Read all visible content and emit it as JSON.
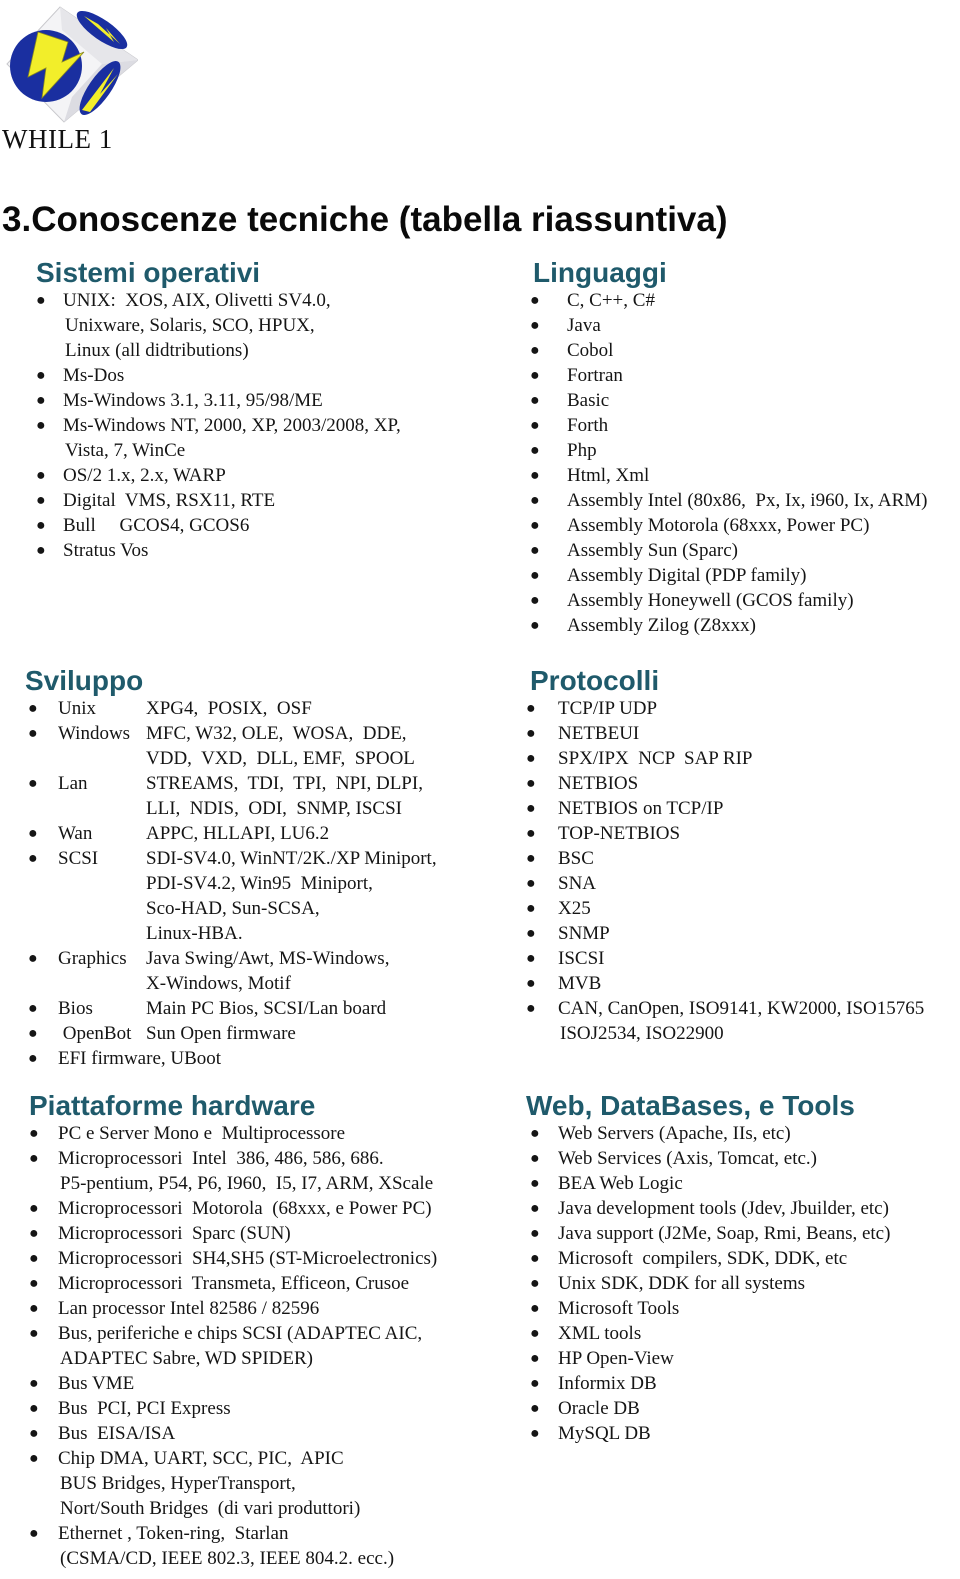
{
  "header": {
    "brand": "WHILE 1",
    "logo_icon": "while1-cube-logo",
    "title": "3.Conoscenze tecniche (tabella riassuntiva)"
  },
  "colors": {
    "heading": "#1f5a6b",
    "text": "#151515",
    "logo_blue": "#1a2fa0",
    "logo_yellow": "#f2ee2a"
  },
  "sections": {
    "sistemi": {
      "title": "Sistemi operativi",
      "items": [
        [
          "UNIX:  XOS, AIX, Olivetti SV4.0,",
          "Unixware, Solaris, SCO, HPUX,",
          "Linux (all didtributions)"
        ],
        [
          "Ms-Dos"
        ],
        [
          "Ms-Windows 3.1, 3.11, 95/98/ME"
        ],
        [
          "Ms-Windows NT, 2000, XP, 2003/2008, XP,",
          "Vista, 7, WinCe"
        ],
        [
          "OS/2 1.x, 2.x, WARP"
        ],
        [
          "Digital  VMS, RSX11, RTE"
        ],
        [
          "Bull     GCOS4, GCOS6"
        ],
        [
          "Stratus Vos"
        ]
      ]
    },
    "linguaggi": {
      "title": "Linguaggi",
      "items": [
        [
          "C, C++, C#"
        ],
        [
          "Java"
        ],
        [
          "Cobol"
        ],
        [
          "Fortran"
        ],
        [
          "Basic"
        ],
        [
          "Forth"
        ],
        [
          "Php"
        ],
        [
          "Html, Xml"
        ],
        [
          "Assembly Intel (80x86,  Px, Ix, i960, Ix, ARM)"
        ],
        [
          "Assembly Motorola (68xxx, Power PC)"
        ],
        [
          "Assembly Sun (Sparc)"
        ],
        [
          "Assembly Digital (PDP family)"
        ],
        [
          "Assembly Honeywell (GCOS family)"
        ],
        [
          "Assembly Zilog (Z8xxx)"
        ]
      ]
    },
    "sviluppo": {
      "title": "Sviluppo",
      "items": [
        {
          "key": "Unix",
          "values": [
            "XPG4,  POSIX,  OSF"
          ]
        },
        {
          "key": "Windows",
          "values": [
            "MFC, W32, OLE,  WOSA,  DDE,",
            "VDD,  VXD,  DLL, EMF,  SPOOL"
          ]
        },
        {
          "key": "Lan",
          "values": [
            "STREAMS,  TDI,  TPI,  NPI, DLPI,",
            "LLI,  NDIS,  ODI,  SNMP, ISCSI"
          ]
        },
        {
          "key": "Wan",
          "values": [
            "APPC, HLLAPI, LU6.2"
          ]
        },
        {
          "key": "SCSI",
          "values": [
            "SDI-SV4.0, WinNT/2K./XP Miniport,",
            "PDI-SV4.2, Win95  Miniport,",
            "Sco-HAD, Sun-SCSA,",
            "Linux-HBA."
          ]
        },
        {
          "key": "Graphics",
          "values": [
            "Java Swing/Awt, MS-Windows,",
            "X-Windows, Motif"
          ]
        },
        {
          "key": "Bios",
          "values": [
            "Main PC Bios, SCSI/Lan board"
          ]
        },
        {
          "key": " OpenBot",
          "values": [
            "Sun Open firmware"
          ]
        },
        {
          "key": "EFI firmware, UBoot",
          "values": []
        }
      ]
    },
    "protocolli": {
      "title": "Protocolli",
      "items": [
        [
          "TCP/IP UDP"
        ],
        [
          "NETBEUI"
        ],
        [
          "SPX/IPX  NCP  SAP RIP"
        ],
        [
          "NETBIOS"
        ],
        [
          "NETBIOS on TCP/IP"
        ],
        [
          "TOP-NETBIOS"
        ],
        [
          "BSC"
        ],
        [
          "SNA"
        ],
        [
          "X25"
        ],
        [
          "SNMP"
        ],
        [
          "ISCSI"
        ],
        [
          "MVB"
        ],
        [
          "CAN, CanOpen, ISO9141, KW2000, ISO15765",
          "ISOJ2534, ISO22900"
        ]
      ]
    },
    "hardware": {
      "title": "Piattaforme hardware",
      "items": [
        [
          "PC e Server Mono e  Multiprocessore"
        ],
        [
          "Microprocessori  Intel  386, 486, 586, 686.",
          "P5-pentium, P54, P6, I960,  I5, I7, ARM, XScale"
        ],
        [
          "Microprocessori  Motorola  (68xxx, e Power PC)"
        ],
        [
          "Microprocessori  Sparc (SUN)"
        ],
        [
          "Microprocessori  SH4,SH5 (ST-Microelectronics)"
        ],
        [
          "Microprocessori  Transmeta, Efficeon, Crusoe"
        ],
        [
          "Lan processor Intel 82586 / 82596"
        ],
        [
          "Bus, periferiche e chips SCSI (ADAPTEC AIC,",
          "ADAPTEC Sabre, WD SPIDER)"
        ],
        [
          "Bus VME"
        ],
        [
          "Bus  PCI, PCI Express"
        ],
        [
          "Bus  EISA/ISA"
        ],
        [
          "Chip DMA, UART, SCC, PIC,  APIC",
          "BUS Bridges, HyperTransport,",
          "Nort/South Bridges  (di vari produttori)"
        ],
        [
          "Ethernet , Token-ring,  Starlan",
          "(CSMA/CD, IEEE 802.3, IEEE 804.2. ecc.)"
        ]
      ]
    },
    "web": {
      "title": "Web, DataBases,  e Tools",
      "items": [
        [
          "Web Servers (Apache, IIs, etc)"
        ],
        [
          "Web Services (Axis, Tomcat, etc.)"
        ],
        [
          "BEA Web Logic"
        ],
        [
          "Java development tools (Jdev, Jbuilder, etc)"
        ],
        [
          "Java support (J2Me, Soap, Rmi, Beans, etc)"
        ],
        [
          "Microsoft  compilers, SDK, DDK, etc"
        ],
        [
          "Unix SDK, DDK for all systems"
        ],
        [
          "Microsoft Tools"
        ],
        [
          "XML tools"
        ],
        [
          "HP Open-View"
        ],
        [
          "Informix DB"
        ],
        [
          "Oracle DB"
        ],
        [
          "MySQL DB"
        ]
      ]
    }
  }
}
